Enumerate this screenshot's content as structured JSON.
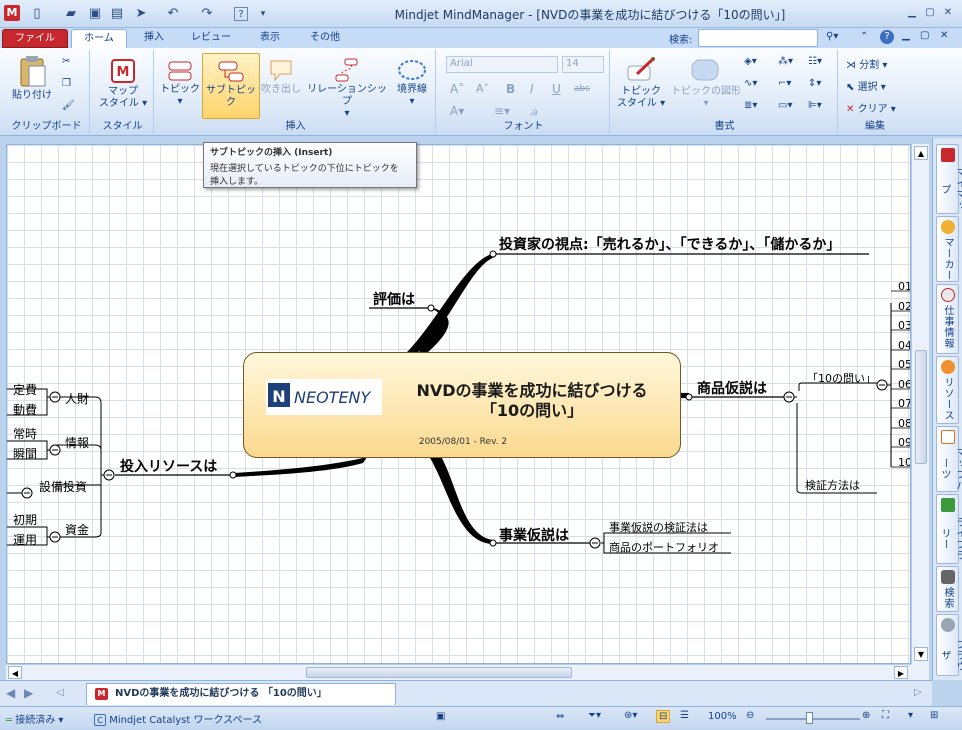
{
  "window": {
    "title": "Mindjet MindManager - [NVDの事業を成功に結びつける「10の問い」]"
  },
  "ribbon_tabs": {
    "file": "ファイル",
    "home": "ホーム",
    "insert": "挿入",
    "review": "レビュー",
    "view": "表示",
    "other": "その他"
  },
  "search": {
    "label": "検索:",
    "value": ""
  },
  "ribbon": {
    "clipboard": {
      "paste": "貼り付け",
      "group": "クリップボード"
    },
    "style": {
      "map_style_1": "マップ",
      "map_style_2": "スタイル",
      "group": "スタイル"
    },
    "insert": {
      "topic": "トピック",
      "subtopic": "サブトピック",
      "callout": "吹き出し",
      "relationship": "リレーションシップ",
      "boundary": "境界線",
      "group": "挿入"
    },
    "font": {
      "name": "Arial",
      "size": "14",
      "group": "フォント",
      "bold": "B",
      "italic": "I",
      "underline": "U",
      "strike": "abc"
    },
    "format": {
      "topic_style_1": "トピック",
      "topic_style_2": "スタイル",
      "topic_shape": "トピックの図形",
      "group": "書式"
    },
    "edit": {
      "split": "分割",
      "select": "選択",
      "clear": "クリア",
      "group": "編集"
    }
  },
  "tooltip": {
    "title": "サブトピックの挿入 (Insert)",
    "line1": "現在選択しているトピックの下位にトピックを",
    "line2": "挿入します。"
  },
  "map": {
    "central_title_1": "NVDの事業を成功に結びつける",
    "central_title_2": "「10の問い」",
    "central_logo": "NEOTENY",
    "central_date": "2005/08/01 - Rev. 2",
    "investor_view": "投資家の視点:「売れるか」、「できるか」、「儲かるか」",
    "evaluation": "評価は",
    "product_hypothesis": "商品仮説は",
    "ten_questions": "「10の問い」",
    "verification": "検証方法は",
    "business_hypothesis": "事業仮説は",
    "biz_verification": "事業仮説の検証法は",
    "portfolio": "商品のポートフォリオ",
    "resources": "投入リソースは",
    "people": "人財",
    "fixed": "定費",
    "variable": "動費",
    "info": "情報",
    "constant": "常時",
    "moment": "瞬間",
    "equipment": "設備投資",
    "funds": "資金",
    "initial": "初期",
    "operation": "運用",
    "numbers": [
      "01",
      "02",
      "03",
      "04",
      "05",
      "06",
      "07",
      "08",
      "09",
      "10"
    ]
  },
  "right_pane": [
    "マイマップ",
    "マーカー",
    "仕事情報",
    "リソース",
    "マップパーツ",
    "ライブラリー",
    "検索",
    "ブラウザ"
  ],
  "doc_tab": "NVDの事業を成功に結びつける 「10の問い」",
  "status": {
    "connection": "接続済み",
    "workspace": "Mindjet Catalyst ワークスペース",
    "zoom": "100%"
  },
  "colors": {
    "central_fill": "#fde7ad",
    "accent": "#c8282d"
  }
}
